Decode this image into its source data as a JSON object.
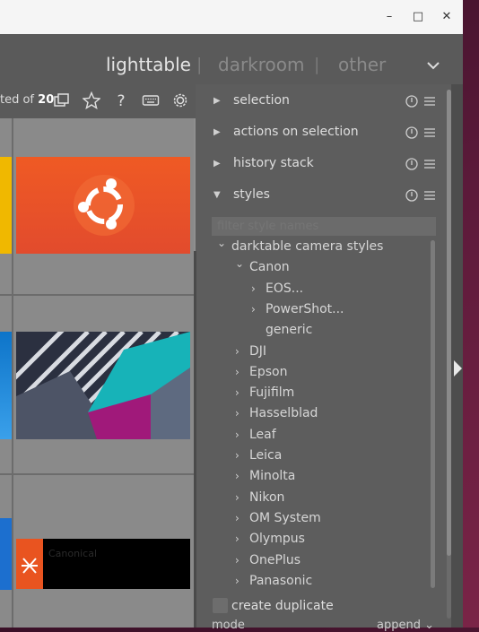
{
  "window": {
    "controls": {
      "minimize": "–",
      "maximize": "□",
      "close": "✕"
    }
  },
  "views": {
    "tabs": [
      "lighttable",
      "darkroom",
      "other"
    ],
    "active": "lighttable",
    "separator": "|"
  },
  "toolbar": {
    "selection_text": "ted of ",
    "selection_total": "20",
    "icons": [
      "copy-icon",
      "star-icon",
      "help-icon",
      "keyboard-icon",
      "gear-icon"
    ]
  },
  "thumbnails": [
    {
      "name": "ubuntu-logo-thumb",
      "label": ""
    },
    {
      "name": "abstract-stripes-thumb",
      "label": ""
    },
    {
      "name": "canonical-thumb",
      "label": "Canonical"
    }
  ],
  "modules": [
    {
      "label": "selection",
      "expanded": false
    },
    {
      "label": "actions on selection",
      "expanded": false
    },
    {
      "label": "history stack",
      "expanded": false
    },
    {
      "label": "styles",
      "expanded": true
    }
  ],
  "styles": {
    "filter_placeholder": "filter style names",
    "tree": [
      {
        "label": "darktable camera styles",
        "level": 0,
        "arrow": "v"
      },
      {
        "label": "Canon",
        "level": 1,
        "arrow": "v"
      },
      {
        "label": "EOS...",
        "level": 2,
        "arrow": ">"
      },
      {
        "label": "PowerShot...",
        "level": 2,
        "arrow": ">"
      },
      {
        "label": "generic",
        "level": 2,
        "arrow": ""
      },
      {
        "label": "DJI",
        "level": 1,
        "arrow": ">"
      },
      {
        "label": "Epson",
        "level": 1,
        "arrow": ">"
      },
      {
        "label": "Fujifilm",
        "level": 1,
        "arrow": ">"
      },
      {
        "label": "Hasselblad",
        "level": 1,
        "arrow": ">"
      },
      {
        "label": "Leaf",
        "level": 1,
        "arrow": ">"
      },
      {
        "label": "Leica",
        "level": 1,
        "arrow": ">"
      },
      {
        "label": "Minolta",
        "level": 1,
        "arrow": ">"
      },
      {
        "label": "Nikon",
        "level": 1,
        "arrow": ">"
      },
      {
        "label": "OM System",
        "level": 1,
        "arrow": ">"
      },
      {
        "label": "Olympus",
        "level": 1,
        "arrow": ">"
      },
      {
        "label": "OnePlus",
        "level": 1,
        "arrow": ">"
      },
      {
        "label": "Panasonic",
        "level": 1,
        "arrow": ">"
      }
    ],
    "create_duplicate": "create duplicate",
    "create_duplicate_checked": false,
    "mode_label": "mode",
    "mode_value": "append"
  },
  "colors": {
    "ubuntu_orange": "#e95420",
    "teal": "#17b3b8",
    "magenta": "#a0197a"
  }
}
